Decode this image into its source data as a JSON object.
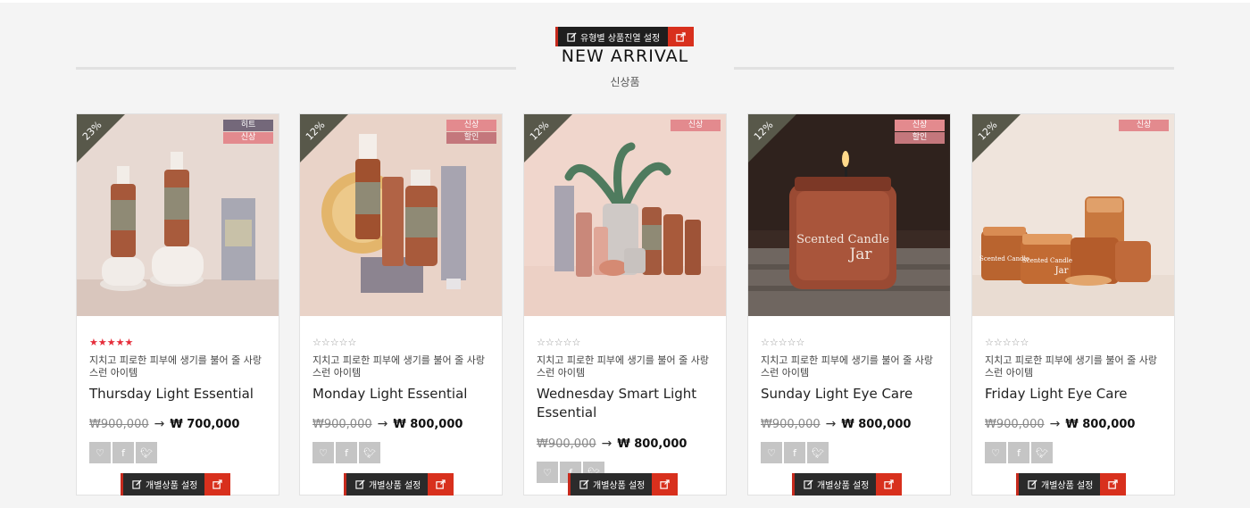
{
  "section": {
    "edit_label": "유형별 상품진열 설정",
    "title": "NEW ARRIVAL",
    "subtitle": "신상품"
  },
  "colors": {
    "accent": "#d8301d",
    "dark": "#1e1e1e",
    "badge_hit": "#74687a",
    "badge_new": "#e38a8e",
    "badge_sale": "#c4777c"
  },
  "products": [
    {
      "discount": "23%",
      "badges": [
        "히트",
        "신상"
      ],
      "rating": "★★★★★",
      "desc": "지치고 피로한 피부에 생기를 불어 줄 사랑스런 아이템",
      "name": "Thursday Light Essential",
      "old_price": "₩900,000",
      "price": "₩ 700,000",
      "edit_label": "개별상품 설정"
    },
    {
      "discount": "12%",
      "badges": [
        "신상",
        "할인"
      ],
      "rating": "☆☆☆☆☆",
      "desc": "지치고 피로한 피부에 생기를 불어 줄 사랑스런 아이템",
      "name": "Monday Light Essential",
      "old_price": "₩900,000",
      "price": "₩ 800,000",
      "edit_label": "개별상품 설정"
    },
    {
      "discount": "12%",
      "badges": [
        "신상"
      ],
      "rating": "☆☆☆☆☆",
      "desc": "지치고 피로한 피부에 생기를 불어 줄 사랑스런 아이템",
      "name": "Wednesday Smart Light Essential",
      "old_price": "₩900,000",
      "price": "₩ 800,000",
      "edit_label": "개별상품 설정"
    },
    {
      "discount": "12%",
      "badges": [
        "신상",
        "할인"
      ],
      "rating": "☆☆☆☆☆",
      "desc": "지치고 피로한 피부에 생기를 불어 줄 사랑스런 아이템",
      "name": "Sunday Light Eye Care",
      "old_price": "₩900,000",
      "price": "₩ 800,000",
      "edit_label": "개별상품 설정"
    },
    {
      "discount": "12%",
      "badges": [
        "신상"
      ],
      "rating": "☆☆☆☆☆",
      "desc": "지치고 피로한 피부에 생기를 불어 줄 사랑스런 아이템",
      "name": "Friday Light Eye Care",
      "old_price": "₩900,000",
      "price": "₩ 800,000",
      "edit_label": "개별상품 설정"
    }
  ],
  "icons": {
    "edit": "edit-icon",
    "external": "external-link-icon",
    "wishlist": "heart-icon",
    "facebook": "facebook-icon",
    "twitter": "twitter-icon"
  },
  "social": {
    "facebook": "f",
    "twitter": "t"
  }
}
